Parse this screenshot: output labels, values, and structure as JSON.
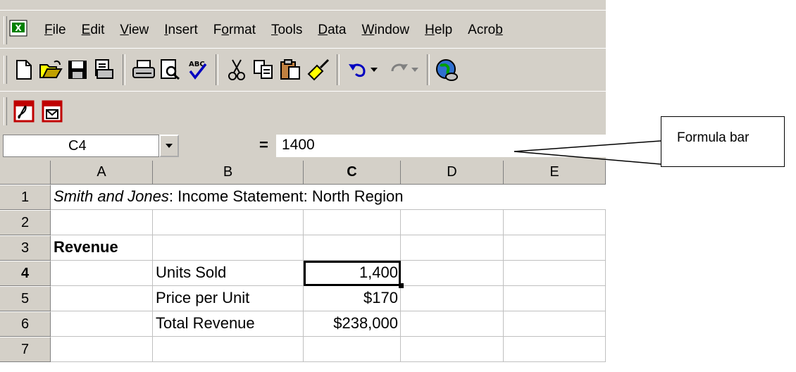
{
  "menu": {
    "items": [
      {
        "pre": "",
        "ul": "F",
        "post": "ile"
      },
      {
        "pre": "",
        "ul": "E",
        "post": "dit"
      },
      {
        "pre": "",
        "ul": "V",
        "post": "iew"
      },
      {
        "pre": "",
        "ul": "I",
        "post": "nsert"
      },
      {
        "pre": "F",
        "ul": "o",
        "post": "rmat"
      },
      {
        "pre": "",
        "ul": "T",
        "post": "ools"
      },
      {
        "pre": "",
        "ul": "D",
        "post": "ata"
      },
      {
        "pre": "",
        "ul": "W",
        "post": "indow"
      },
      {
        "pre": "",
        "ul": "H",
        "post": "elp"
      },
      {
        "pre": "Acro",
        "ul": "b",
        "post": ""
      }
    ]
  },
  "toolbar": {
    "icons": [
      "new-icon",
      "open-icon",
      "save-icon",
      "print-preview-setup-icon",
      "print-icon",
      "print-preview-icon",
      "spelling-icon",
      "cut-icon",
      "copy-icon",
      "paste-icon",
      "format-painter-icon",
      "undo-icon",
      "redo-icon",
      "web-icon"
    ],
    "pdf_icons": [
      "convert-to-pdf-icon",
      "convert-and-email-pdf-icon"
    ]
  },
  "formula_bar": {
    "name_box": "C4",
    "equals": "=",
    "content": "1400"
  },
  "sheet": {
    "columns": [
      "A",
      "B",
      "C",
      "D",
      "E"
    ],
    "rows": [
      "1",
      "2",
      "3",
      "4",
      "5",
      "6",
      "7"
    ],
    "r1_italic": "Smith and Jones",
    "r1_rest": ": Income Statement: North Region",
    "a3": "Revenue",
    "b4": "Units Sold",
    "c4": "1,400",
    "b5": "Price per Unit",
    "c5": "$170",
    "b6": "Total Revenue",
    "c6": "$238,000"
  },
  "callout": {
    "label": "Formula bar"
  },
  "colors": {
    "chrome": "#d4d0c8",
    "pdf_red": "#c00000"
  }
}
